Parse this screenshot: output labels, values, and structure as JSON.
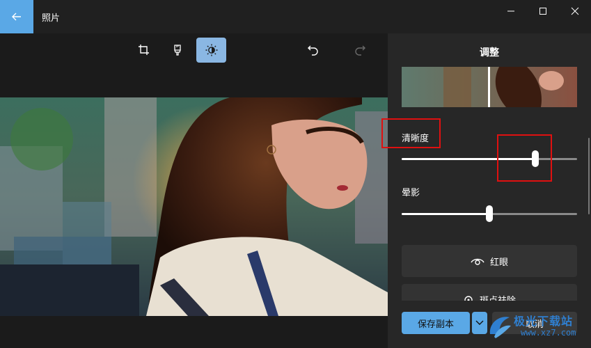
{
  "titlebar": {
    "title": "照片"
  },
  "toolbar": {
    "tools": [
      {
        "name": "crop-icon",
        "active": false
      },
      {
        "name": "markup-icon",
        "active": false
      },
      {
        "name": "adjust-icon",
        "active": true
      }
    ]
  },
  "panel": {
    "title": "调整",
    "sliders": [
      {
        "label": "清晰度",
        "value": 0.76
      },
      {
        "label": "晕影",
        "value": 0.5
      }
    ],
    "actions": [
      {
        "label": "红眼",
        "icon": "eye-icon"
      },
      {
        "label": "斑点祛除",
        "icon": "spot-fix-icon"
      }
    ]
  },
  "footer": {
    "save_copy": "保存副本",
    "cancel": "取消"
  },
  "watermark": {
    "title": "极光下载站",
    "url": "www.xz7.com"
  },
  "colors": {
    "accent": "#5aa8e6",
    "highlight": "#e01010"
  }
}
